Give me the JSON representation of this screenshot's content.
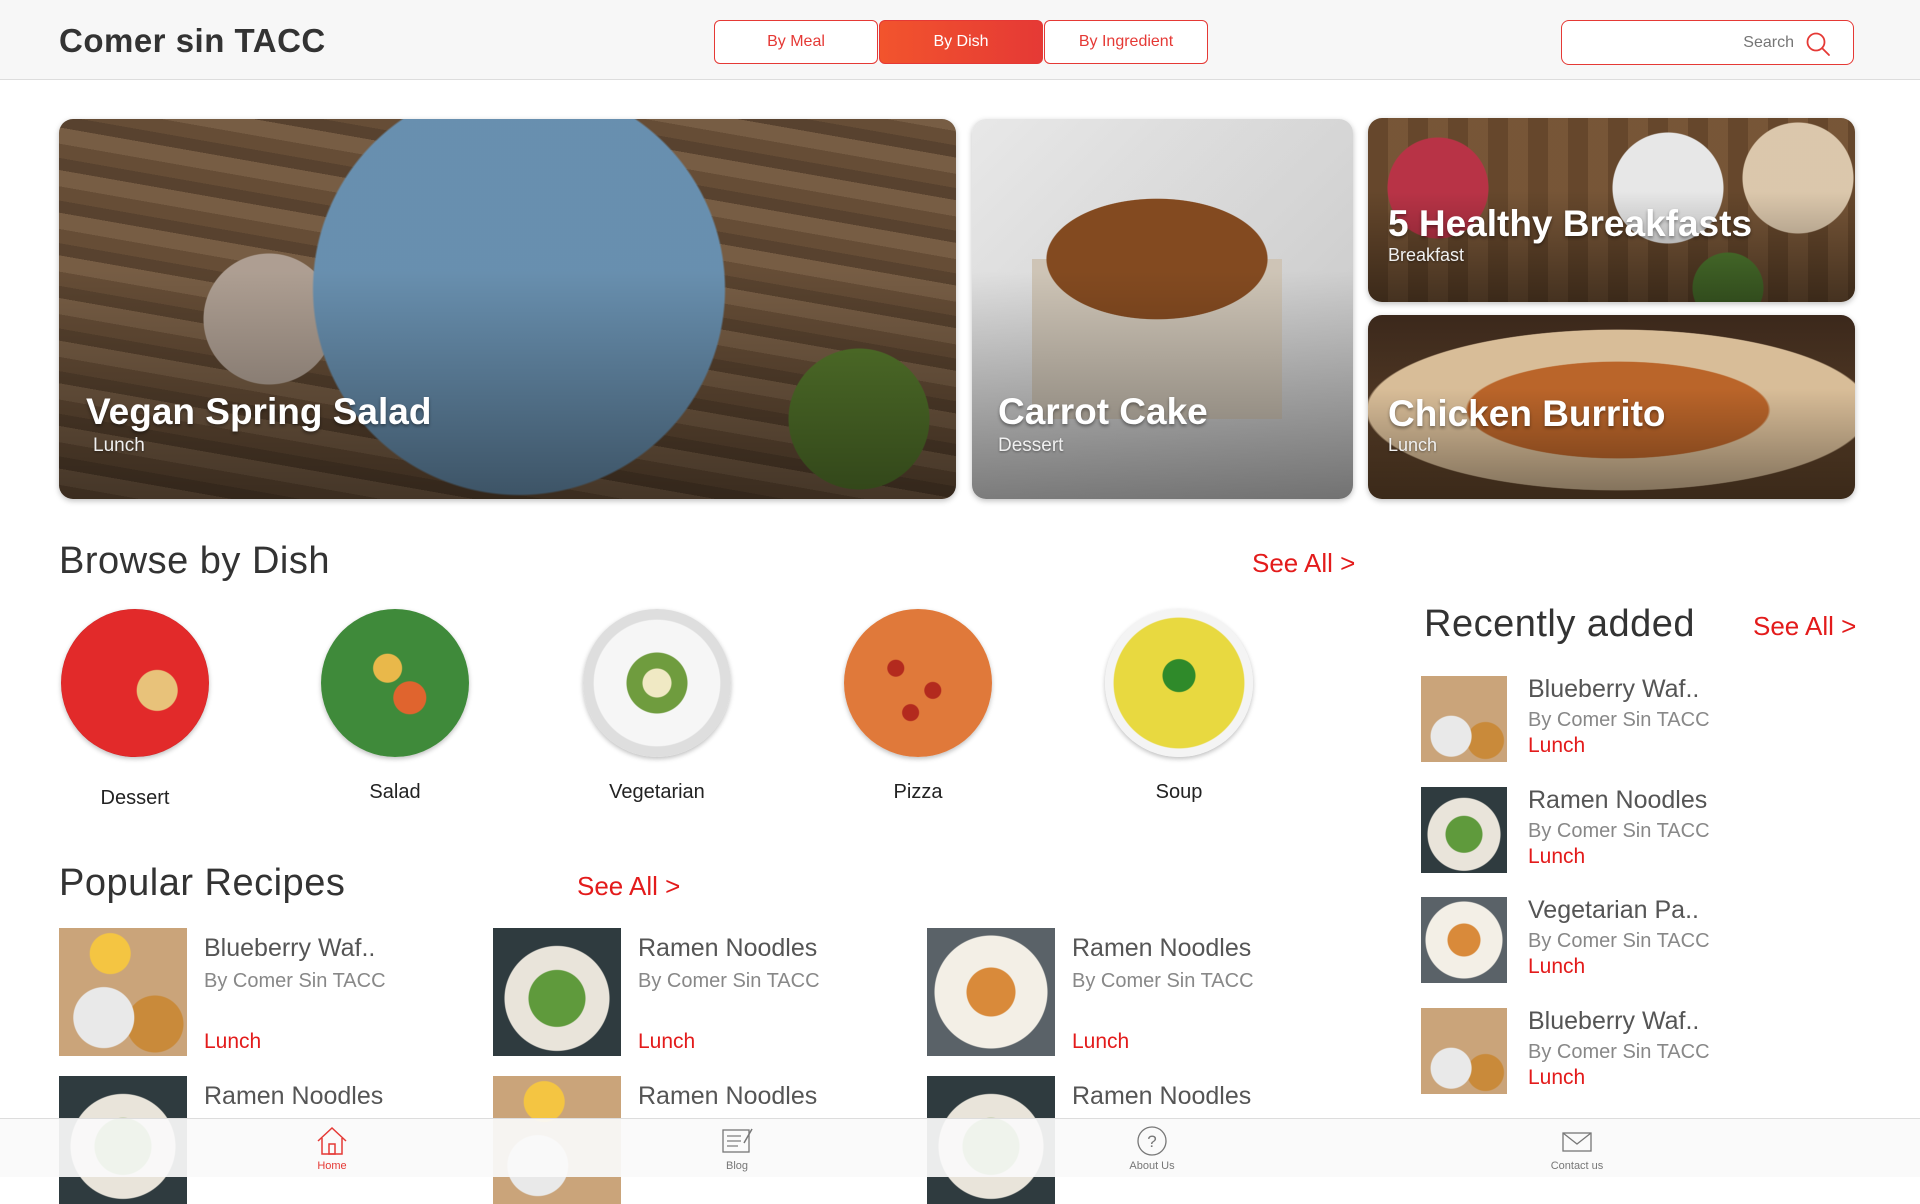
{
  "app": {
    "title": "Comer sin TACC"
  },
  "filters": {
    "by_meal": "By Meal",
    "by_dish": "By Dish",
    "by_ingredient": "By Ingredient",
    "active": "By Dish"
  },
  "search": {
    "placeholder": "Search"
  },
  "featured": [
    {
      "title": "Vegan Spring Salad",
      "category": "Lunch"
    },
    {
      "title": "Carrot Cake",
      "category": "Dessert"
    },
    {
      "title": "5 Healthy Breakfasts",
      "category": "Breakfast"
    },
    {
      "title": "Chicken Burrito",
      "category": "Lunch"
    }
  ],
  "browse": {
    "heading": "Browse by Dish",
    "see_all": "See All >",
    "dishes": [
      "Dessert",
      "Salad",
      "Vegetarian",
      "Pizza",
      "Soup"
    ]
  },
  "popular": {
    "heading": "Popular Recipes",
    "see_all": "See All >",
    "recipes": [
      {
        "name": "Blueberry Waf..",
        "by": "By Comer Sin TACC",
        "category": "Lunch"
      },
      {
        "name": "Ramen Noodles",
        "by": "By Comer Sin TACC",
        "category": "Lunch"
      },
      {
        "name": "Ramen Noodles",
        "by": "By Comer Sin TACC",
        "category": "Lunch"
      },
      {
        "name": "Ramen Noodles",
        "by": "",
        "category": ""
      },
      {
        "name": "Ramen Noodles",
        "by": "",
        "category": ""
      },
      {
        "name": "Ramen Noodles",
        "by": "",
        "category": ""
      }
    ]
  },
  "recent": {
    "heading": "Recently added",
    "see_all": "See All >",
    "items": [
      {
        "name": "Blueberry Waf..",
        "by": "By Comer Sin TACC",
        "category": "Lunch"
      },
      {
        "name": "Ramen Noodles",
        "by": "By Comer Sin TACC",
        "category": "Lunch"
      },
      {
        "name": "Vegetarian Pa..",
        "by": "By Comer Sin TACC",
        "category": "Lunch"
      },
      {
        "name": "Blueberry Waf..",
        "by": "By Comer Sin TACC",
        "category": "Lunch"
      }
    ]
  },
  "nav": {
    "home": "Home",
    "blog": "Blog",
    "about": "About Us",
    "contact": "Contact us",
    "active": "Home"
  },
  "colors": {
    "accent": "#e53935",
    "link": "#e31b1b"
  }
}
